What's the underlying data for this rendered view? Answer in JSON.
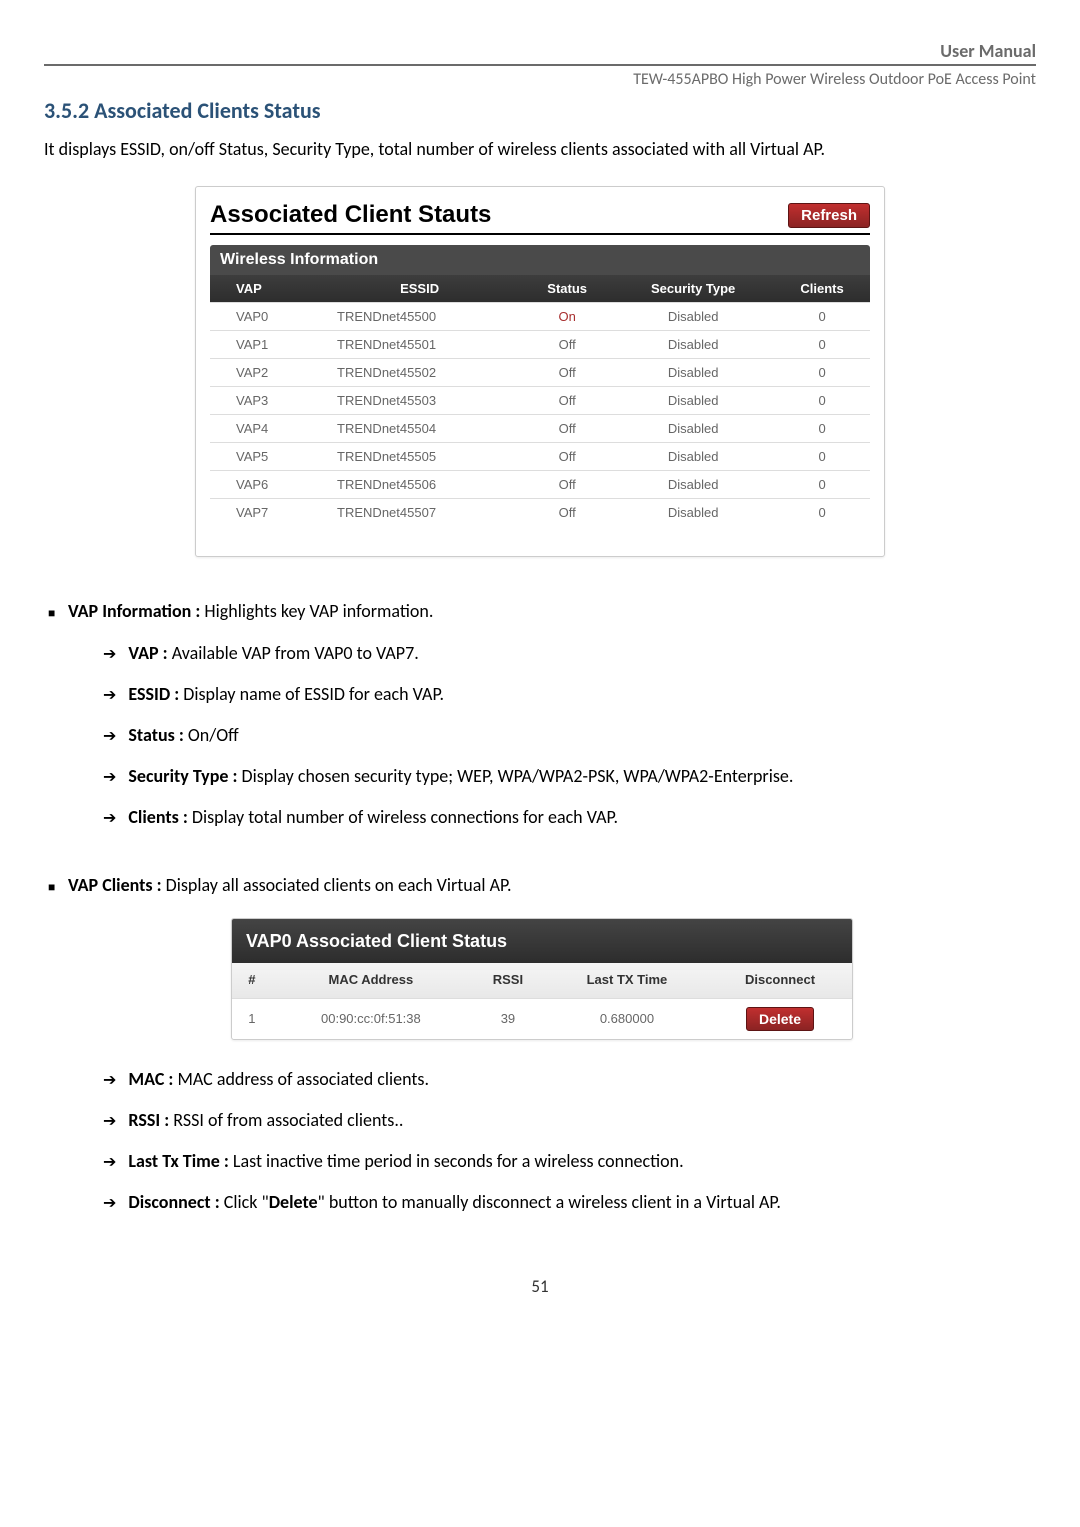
{
  "header": {
    "manual": "User Manual",
    "device": "TEW-455APBO High Power Wireless Outdoor PoE Access Point"
  },
  "section_title": "3.5.2 Associated Clients Status",
  "intro": "It displays ESSID, on/off Status, Security Type, total number of wireless clients associated with all Virtual AP.",
  "panel1": {
    "title": "Associated Client Stauts",
    "refresh": "Refresh",
    "subtitle": "Wireless Information",
    "headers": {
      "vap": "VAP",
      "essid": "ESSID",
      "status": "Status",
      "security": "Security Type",
      "clients": "Clients"
    },
    "rows": [
      {
        "vap": "VAP0",
        "essid": "TRENDnet45500",
        "status": "On",
        "on": true,
        "security": "Disabled",
        "clients": "0"
      },
      {
        "vap": "VAP1",
        "essid": "TRENDnet45501",
        "status": "Off",
        "on": false,
        "security": "Disabled",
        "clients": "0"
      },
      {
        "vap": "VAP2",
        "essid": "TRENDnet45502",
        "status": "Off",
        "on": false,
        "security": "Disabled",
        "clients": "0"
      },
      {
        "vap": "VAP3",
        "essid": "TRENDnet45503",
        "status": "Off",
        "on": false,
        "security": "Disabled",
        "clients": "0"
      },
      {
        "vap": "VAP4",
        "essid": "TRENDnet45504",
        "status": "Off",
        "on": false,
        "security": "Disabled",
        "clients": "0"
      },
      {
        "vap": "VAP5",
        "essid": "TRENDnet45505",
        "status": "Off",
        "on": false,
        "security": "Disabled",
        "clients": "0"
      },
      {
        "vap": "VAP6",
        "essid": "TRENDnet45506",
        "status": "Off",
        "on": false,
        "security": "Disabled",
        "clients": "0"
      },
      {
        "vap": "VAP7",
        "essid": "TRENDnet45507",
        "status": "Off",
        "on": false,
        "security": "Disabled",
        "clients": "0"
      }
    ]
  },
  "list1": {
    "title_bold": "VAP Information :",
    "title_rest": " Highlights key VAP information.",
    "items": [
      {
        "b": "VAP :",
        "t": " Available VAP from VAP0 to VAP7."
      },
      {
        "b": "ESSID :",
        "t": " Display name of ESSID for each VAP."
      },
      {
        "b": "Status :",
        "t": " On/Off"
      },
      {
        "b": "Security Type :",
        "t": " Display chosen security type; WEP, WPA/WPA2-PSK, WPA/WPA2-Enterprise."
      },
      {
        "b": "Clients :",
        "t": " Display total number of wireless connections for each VAP."
      }
    ]
  },
  "list2": {
    "title_bold": "VAP Clients :",
    "title_rest": " Display all associated clients on each Virtual AP."
  },
  "panel2": {
    "title": "VAP0 Associated Client Status",
    "headers": {
      "num": "#",
      "mac": "MAC Address",
      "rssi": "RSSI",
      "lasttx": "Last TX Time",
      "disc": "Disconnect"
    },
    "row": {
      "num": "1",
      "mac": "00:90:cc:0f:51:38",
      "rssi": "39",
      "lasttx": "0.680000",
      "delete": "Delete"
    }
  },
  "list3": {
    "items": [
      {
        "b": "MAC :",
        "t": " MAC address of associated clients."
      },
      {
        "b": "RSSI :",
        "t": " RSSI of from associated clients.."
      },
      {
        "b": "Last Tx Time :",
        "t": " Last inactive time period in seconds for a wireless connection."
      },
      {
        "b": "Disconnect :",
        "t1": " Click \"",
        "b2": "Delete",
        "t2": "\" button to manually disconnect a wireless client in a Virtual AP."
      }
    ]
  },
  "page_number": "51"
}
